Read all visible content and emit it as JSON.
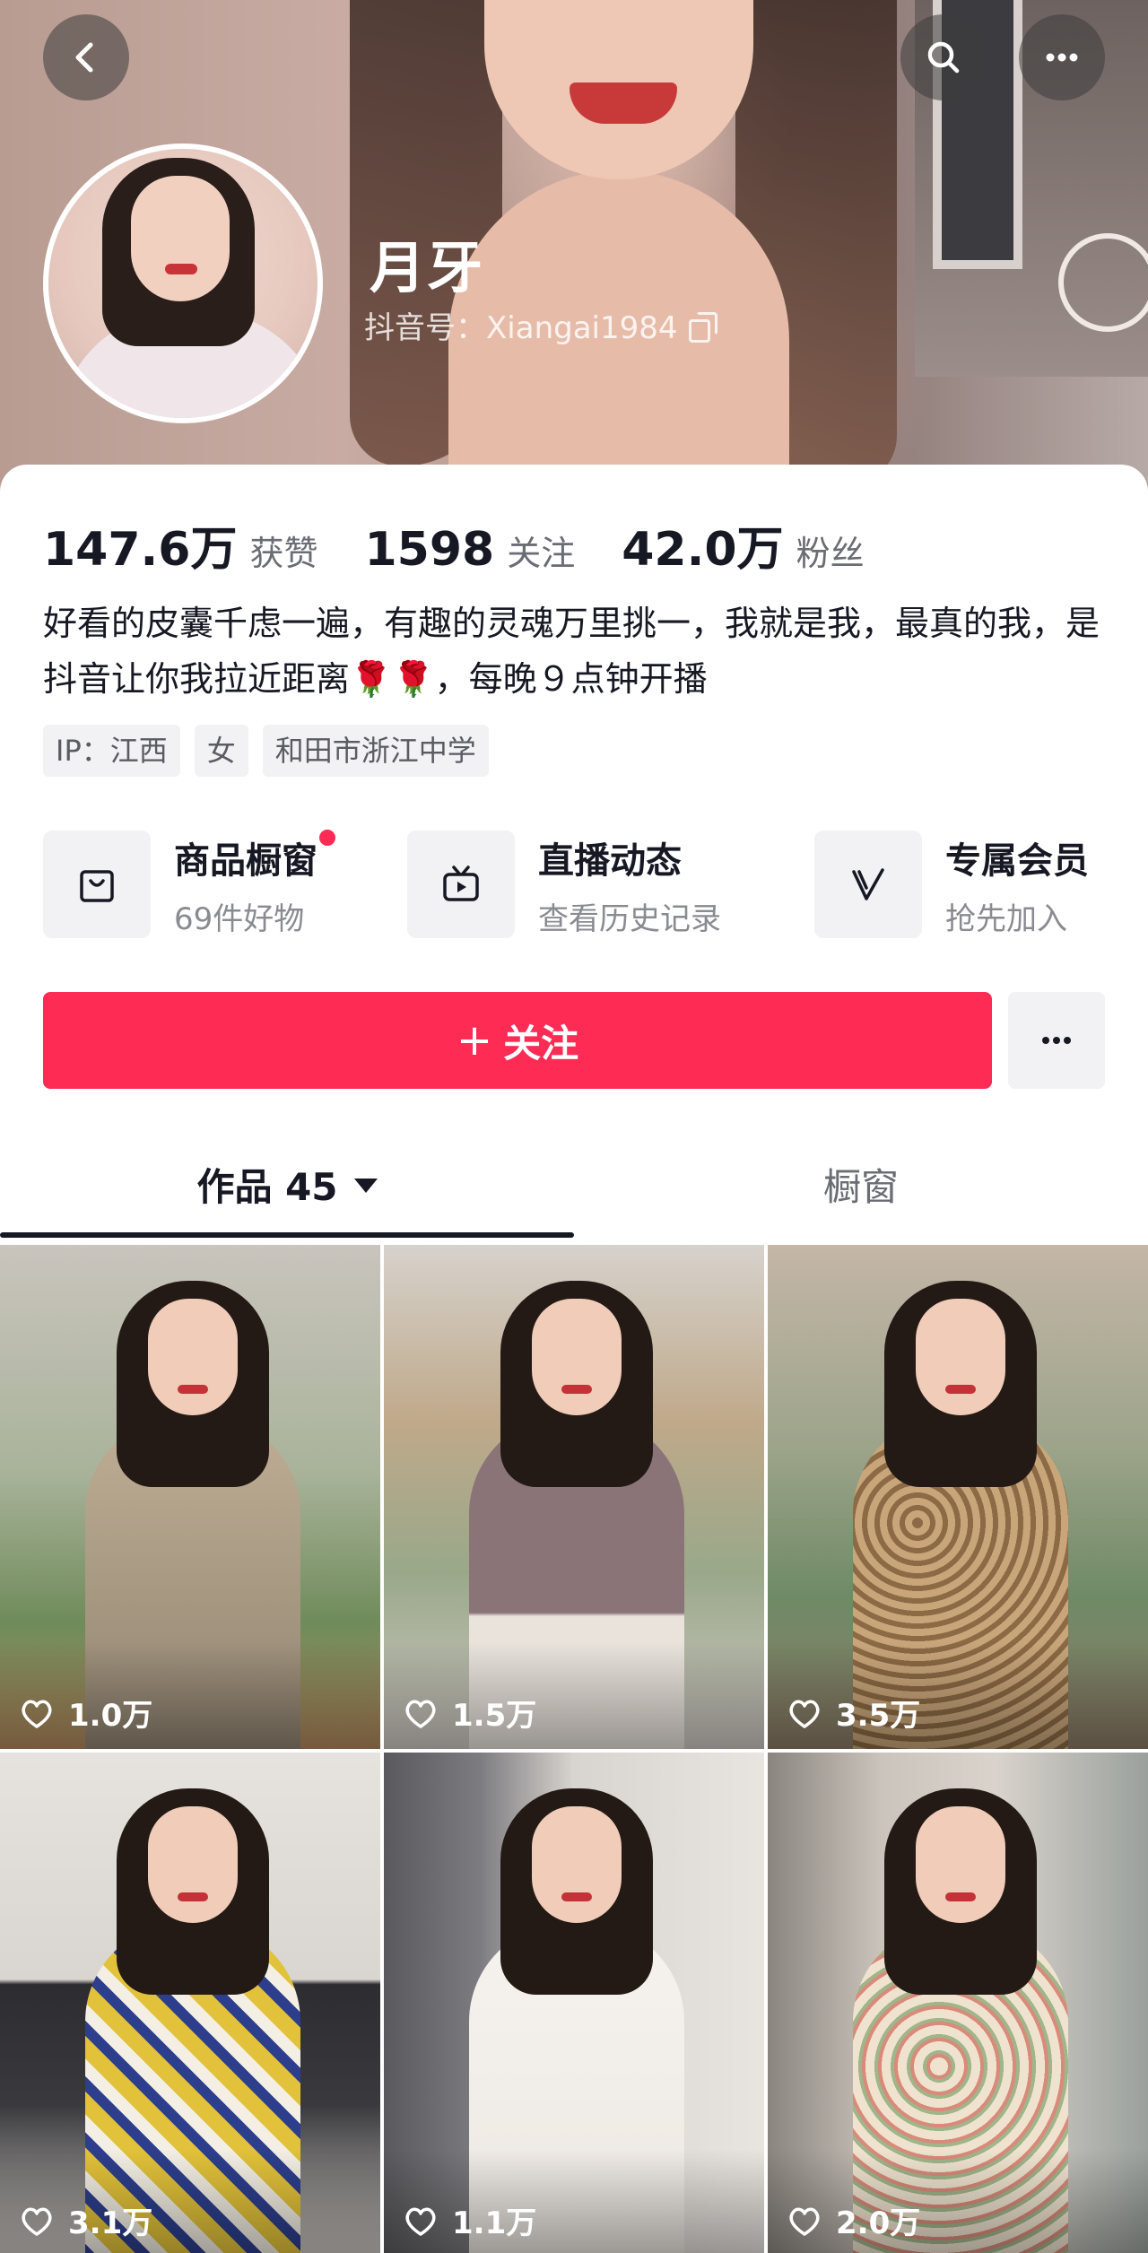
{
  "profile": {
    "nickname": "月牙",
    "douyin_id": "抖音号：Xiangai1984"
  },
  "stats": [
    {
      "value": "147.6万",
      "label": "获赞"
    },
    {
      "value": "1598",
      "label": "关注"
    },
    {
      "value": "42.0万",
      "label": "粉丝"
    }
  ],
  "bio": "好看的皮囊千虑一遍，有趣的灵魂万里挑一，我就是我，最真的我，是抖音让你我拉近距离🌹🌹，每晚９点钟开播",
  "tags": [
    "IP：江西",
    "女",
    "和田市浙江中学"
  ],
  "features": [
    {
      "title": "商品橱窗",
      "subtitle": "69件好物",
      "icon": "shopping-bag-icon"
    },
    {
      "title": "直播动态",
      "subtitle": "查看历史记录",
      "icon": "tv-icon"
    },
    {
      "title": "专属会员",
      "subtitle": "抢先加入",
      "icon": "v-badge-icon"
    }
  ],
  "actions": {
    "follow_label": "关注",
    "follow_color": "#fe2c55"
  },
  "tabs": [
    {
      "label": "作品 45",
      "active": true
    },
    {
      "label": "橱窗",
      "active": false
    }
  ],
  "videos": [
    {
      "likes": "1.0万"
    },
    {
      "likes": "1.5万"
    },
    {
      "likes": "3.5万"
    },
    {
      "likes": "3.1万"
    },
    {
      "likes": "1.1万"
    },
    {
      "likes": "2.0万"
    }
  ]
}
